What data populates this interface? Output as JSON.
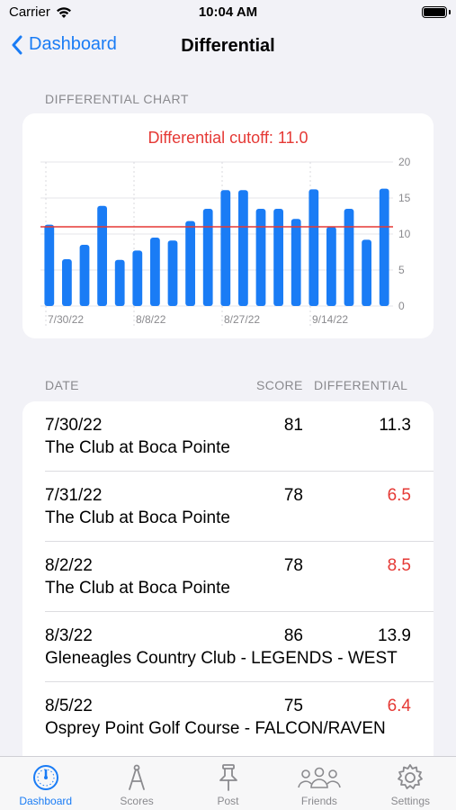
{
  "status": {
    "carrier": "Carrier",
    "time": "10:04 AM"
  },
  "nav": {
    "back_label": "Dashboard",
    "title": "Differential"
  },
  "chart_section": {
    "header": "DIFFERENTIAL CHART"
  },
  "chart_data": {
    "type": "bar",
    "title": "Differential cutoff: 11.0",
    "cutoff": 11.0,
    "ylim": [
      0,
      20
    ],
    "yticks": [
      "0",
      "5",
      "10",
      "15",
      "20"
    ],
    "xtick_labels": [
      "7/30/22",
      "8/8/22",
      "8/27/22",
      "9/14/22"
    ],
    "values": [
      11.3,
      6.5,
      8.5,
      13.9,
      6.4,
      7.7,
      9.5,
      9.1,
      11.8,
      13.5,
      16.1,
      16.1,
      13.5,
      13.5,
      12.1,
      16.2,
      11.0,
      13.5,
      9.2,
      16.3
    ],
    "bar_color": "#1a7cf5",
    "cutoff_color": "#e53935",
    "grid": true
  },
  "table": {
    "headers": {
      "date": "DATE",
      "score": "SCORE",
      "differential": "DIFFERENTIAL"
    },
    "rows": [
      {
        "date": "7/30/22",
        "score": "81",
        "differential": "11.3",
        "course": "The Club at Boca Pointe",
        "below_cutoff": false
      },
      {
        "date": "7/31/22",
        "score": "78",
        "differential": "6.5",
        "course": "The Club at Boca Pointe",
        "below_cutoff": true
      },
      {
        "date": "8/2/22",
        "score": "78",
        "differential": "8.5",
        "course": "The Club at Boca Pointe",
        "below_cutoff": true
      },
      {
        "date": "8/3/22",
        "score": "86",
        "differential": "13.9",
        "course": "Gleneagles Country Club - LEGENDS - WEST",
        "below_cutoff": false
      },
      {
        "date": "8/5/22",
        "score": "75",
        "differential": "6.4",
        "course": "Osprey Point Golf Course - FALCON/RAVEN",
        "below_cutoff": true
      }
    ]
  },
  "tabs": [
    {
      "label": "Dashboard",
      "icon": "gauge-icon",
      "active": true
    },
    {
      "label": "Scores",
      "icon": "compass-icon",
      "active": false
    },
    {
      "label": "Post",
      "icon": "pushpin-icon",
      "active": false
    },
    {
      "label": "Friends",
      "icon": "people-icon",
      "active": false
    },
    {
      "label": "Settings",
      "icon": "gear-icon",
      "active": false
    }
  ],
  "colors": {
    "accent": "#1a7cf5",
    "alert": "#e53935",
    "background": "#f2f2f7"
  }
}
